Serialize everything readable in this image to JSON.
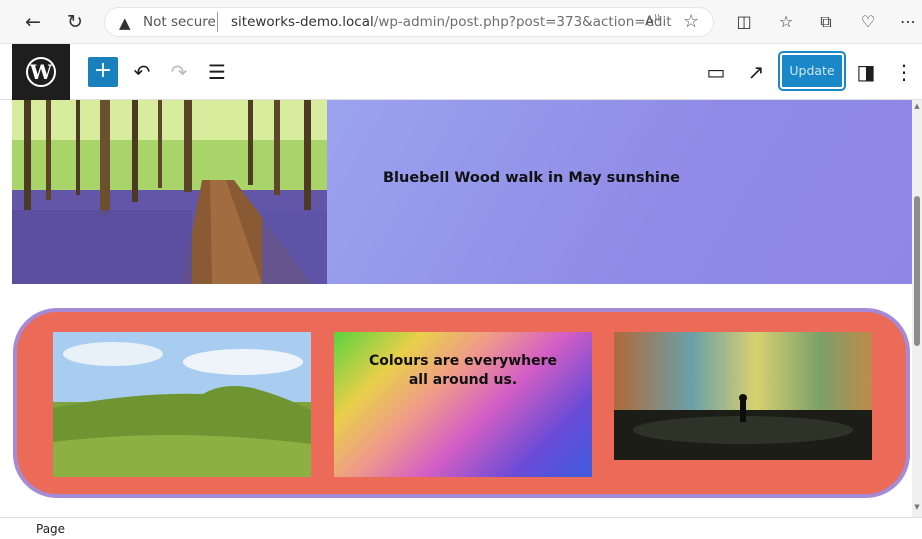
{
  "browser": {
    "address": {
      "security_label": "Not secure",
      "host": "siteworks-demo.local",
      "path": "/wp-admin/post.php?post=373&action=edit"
    }
  },
  "editor": {
    "toolbar": {
      "update_label": "Update"
    }
  },
  "content": {
    "cover": {
      "title": "Bluebell Wood walk in May sunshine"
    },
    "gallery": {
      "text_line1": "Colours are everywhere",
      "text_line2": "all around us."
    }
  },
  "footer": {
    "breadcrumb": "Page"
  }
}
